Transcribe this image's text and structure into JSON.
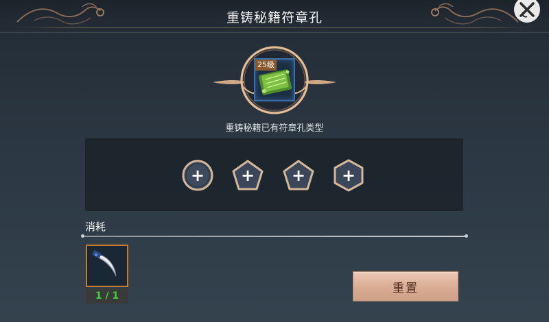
{
  "header": {
    "title": "重铸秘籍符章孔",
    "close_icon": "close-x-icon"
  },
  "book": {
    "level_badge": "25级",
    "icon": "jade-book-icon"
  },
  "subtitle": "重铸秘籍已有符章孔类型",
  "slots": [
    {
      "shape": "circle",
      "icon": "plus-icon",
      "label": "+"
    },
    {
      "shape": "pentagon",
      "icon": "plus-icon",
      "label": "+"
    },
    {
      "shape": "pentagon",
      "icon": "plus-icon",
      "label": "+"
    },
    {
      "shape": "hexagon",
      "icon": "plus-icon",
      "label": "+"
    }
  ],
  "cost": {
    "label": "消耗",
    "item_icon": "claw-blade-icon",
    "item_count": "1 / 1"
  },
  "actions": {
    "reset_label": "重置"
  },
  "colors": {
    "accent_gold": "#e0b58a",
    "slot_border": "#d3b79a",
    "count_green": "#3fd13f",
    "reset_button": "#d9ab93"
  }
}
